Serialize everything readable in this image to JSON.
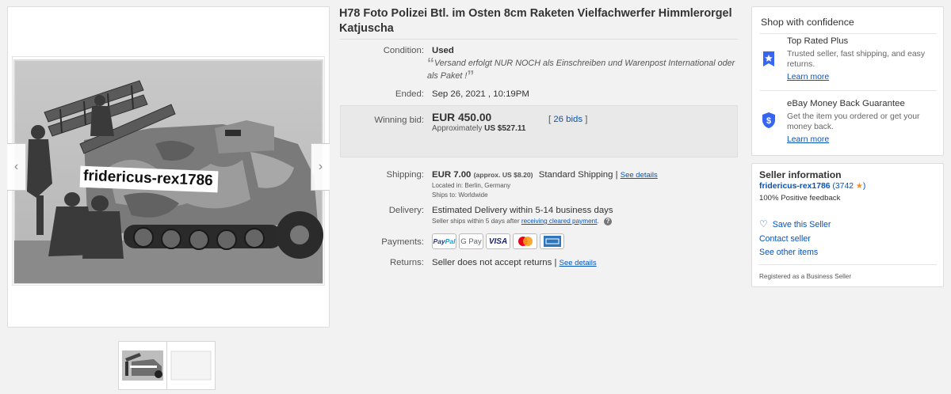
{
  "listing": {
    "title": "H78 Foto Polizei Btl. im Osten 8cm Raketen Vielfachwerfer Himmlerorgel Katjuscha",
    "watermark": "fridericus-rex1786"
  },
  "gallery": {
    "prev_icon": "chevron-left-icon",
    "next_icon": "chevron-right-icon",
    "thumbnails": [
      "photo-front",
      "photo-back"
    ]
  },
  "condition": {
    "label": "Condition:",
    "value": "Used",
    "description": "Versand erfolgt NUR NOCH als Einschreiben und Warenpost International oder als Paket !"
  },
  "ended": {
    "label": "Ended:",
    "value": "Sep 26, 2021 , 10:19PM"
  },
  "bid": {
    "label": "Winning bid:",
    "price": "EUR 450.00",
    "approx_prefix": "Approximately",
    "approx_value": "US $527.11",
    "bids_open": "[",
    "bids_link": "26 bids",
    "bids_close": "]"
  },
  "shipping": {
    "label": "Shipping:",
    "price": "EUR 7.00",
    "approx": "(approx. US $8.20)",
    "service": "Standard Shipping",
    "sep": "|",
    "details_link": "See details",
    "located_label": "Located in:",
    "located_value": "Berlin, Germany",
    "ships_to_label": "Ships to:",
    "ships_to_value": "Worldwide"
  },
  "delivery": {
    "label": "Delivery:",
    "estimate": "Estimated Delivery within 5-14 business days",
    "note_prefix": "Seller ships within 5 days after",
    "note_link": "receiving cleared payment",
    "note_suffix": "."
  },
  "payments": {
    "label": "Payments:",
    "methods": [
      "PayPal",
      "G Pay",
      "VISA",
      "Mastercard",
      "American Express"
    ]
  },
  "returns": {
    "label": "Returns:",
    "value": "Seller does not accept returns",
    "sep": "|",
    "details_link": "See details"
  },
  "shop_confidence": {
    "heading": "Shop with confidence",
    "top_rated": {
      "title": "Top Rated Plus",
      "text": "Trusted seller, fast shipping, and easy returns.",
      "link": "Learn more"
    },
    "money_back": {
      "title": "eBay Money Back Guarantee",
      "text": "Get the item you ordered or get your money back.",
      "link": "Learn more"
    }
  },
  "seller": {
    "heading": "Seller information",
    "name": "fridericus-rex1786",
    "score_open": "(",
    "score": "3742",
    "score_close": ")",
    "feedback": "100% Positive feedback",
    "save": "Save this Seller",
    "contact": "Contact seller",
    "other_items": "See other items",
    "registered": "Registered as a Business Seller"
  },
  "colors": {
    "link": "#0654ba",
    "bid_box": "#e9e9e9",
    "star": "#f18f25"
  }
}
